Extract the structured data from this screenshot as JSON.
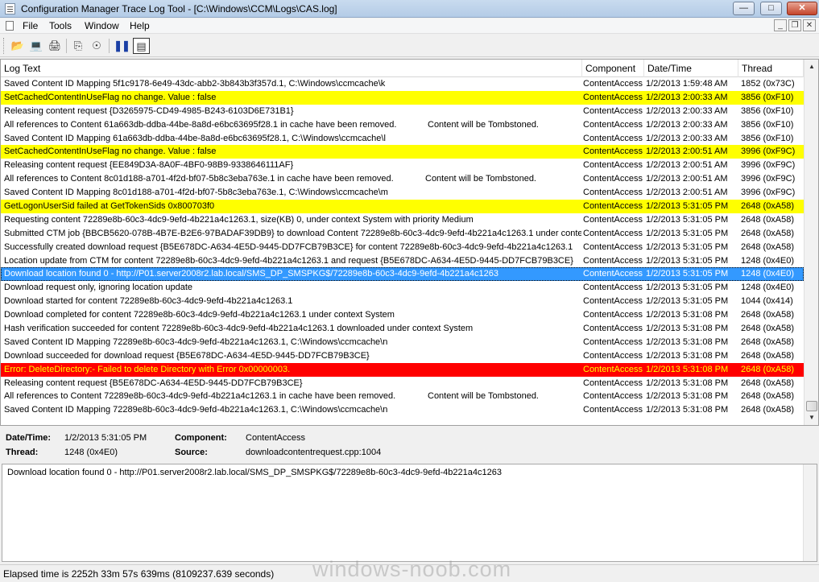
{
  "window": {
    "title": "Configuration Manager Trace Log Tool - [C:\\Windows\\CCM\\Logs\\CAS.log]",
    "min_glyph": "—",
    "max_glyph": "□",
    "close_glyph": "✕"
  },
  "menu": {
    "items": [
      "File",
      "Tools",
      "Window",
      "Help"
    ],
    "mdi_min": "_",
    "mdi_restore": "❐",
    "mdi_close": "✕"
  },
  "toolbar": {
    "buttons": [
      {
        "icon": "open-folder-icon",
        "glyph": "📂"
      },
      {
        "icon": "open-remote-icon",
        "glyph": "💻"
      },
      {
        "icon": "print-icon",
        "glyph": "🖨"
      },
      {
        "icon": "copy-icon",
        "glyph": "⎘"
      },
      {
        "icon": "find-icon",
        "glyph": "☉"
      },
      {
        "icon": "pause-icon",
        "glyph": "❚❚"
      },
      {
        "icon": "info-pane-icon",
        "glyph": "▤"
      }
    ]
  },
  "grid": {
    "columns": [
      "Log Text",
      "Component",
      "Date/Time",
      "Thread"
    ],
    "rows": [
      {
        "text": "Saved Content ID Mapping 5f1c9178-6e49-43dc-abb2-3b843b3f357d.1, C:\\Windows\\ccmcache\\k",
        "tomb": "",
        "component": "ContentAccess",
        "datetime": "1/2/2013 1:59:48 AM",
        "thread": "1852 (0x73C)",
        "status": "normal"
      },
      {
        "text": "SetCachedContentInUseFlag no change. Value : false",
        "tomb": "",
        "component": "ContentAccess",
        "datetime": "1/2/2013 2:00:33 AM",
        "thread": "3856 (0xF10)",
        "status": "warn"
      },
      {
        "text": "Releasing content request {D3265975-CD49-4985-B243-6103D6E731B1}",
        "tomb": "",
        "component": "ContentAccess",
        "datetime": "1/2/2013 2:00:33 AM",
        "thread": "3856 (0xF10)",
        "status": "normal"
      },
      {
        "text": "All references to Content 61a663db-ddba-44be-8a8d-e6bc63695f28.1 in cache have been removed.",
        "tomb": "Content will be Tombstoned.",
        "component": "ContentAccess",
        "datetime": "1/2/2013 2:00:33 AM",
        "thread": "3856 (0xF10)",
        "status": "normal"
      },
      {
        "text": "Saved Content ID Mapping 61a663db-ddba-44be-8a8d-e6bc63695f28.1, C:\\Windows\\ccmcache\\l",
        "tomb": "",
        "component": "ContentAccess",
        "datetime": "1/2/2013 2:00:33 AM",
        "thread": "3856 (0xF10)",
        "status": "normal"
      },
      {
        "text": "SetCachedContentInUseFlag no change. Value : false",
        "tomb": "",
        "component": "ContentAccess",
        "datetime": "1/2/2013 2:00:51 AM",
        "thread": "3996 (0xF9C)",
        "status": "warn"
      },
      {
        "text": "Releasing content request {EE849D3A-8A0F-4BF0-98B9-9338646111AF}",
        "tomb": "",
        "component": "ContentAccess",
        "datetime": "1/2/2013 2:00:51 AM",
        "thread": "3996 (0xF9C)",
        "status": "normal"
      },
      {
        "text": "All references to Content 8c01d188-a701-4f2d-bf07-5b8c3eba763e.1 in cache have been removed.",
        "tomb": "Content will be Tombstoned.",
        "component": "ContentAccess",
        "datetime": "1/2/2013 2:00:51 AM",
        "thread": "3996 (0xF9C)",
        "status": "normal"
      },
      {
        "text": "Saved Content ID Mapping 8c01d188-a701-4f2d-bf07-5b8c3eba763e.1, C:\\Windows\\ccmcache\\m",
        "tomb": "",
        "component": "ContentAccess",
        "datetime": "1/2/2013 2:00:51 AM",
        "thread": "3996 (0xF9C)",
        "status": "normal"
      },
      {
        "text": "GetLogonUserSid failed at GetTokenSids 0x800703f0",
        "tomb": "",
        "component": "ContentAccess",
        "datetime": "1/2/2013 5:31:05 PM",
        "thread": "2648 (0xA58)",
        "status": "warn"
      },
      {
        "text": "Requesting content 72289e8b-60c3-4dc9-9efd-4b221a4c1263.1, size(KB) 0, under context System with priority Medium",
        "tomb": "",
        "component": "ContentAccess",
        "datetime": "1/2/2013 5:31:05 PM",
        "thread": "2648 (0xA58)",
        "status": "normal"
      },
      {
        "text": "Submitted CTM job {BBCB5620-078B-4B7E-B2E6-97BADAF39DB9} to download Content 72289e8b-60c3-4dc9-9efd-4b221a4c1263.1 under context ...",
        "tomb": "",
        "component": "ContentAccess",
        "datetime": "1/2/2013 5:31:05 PM",
        "thread": "2648 (0xA58)",
        "status": "normal"
      },
      {
        "text": "Successfully created download  request {B5E678DC-A634-4E5D-9445-DD7FCB79B3CE} for content 72289e8b-60c3-4dc9-9efd-4b221a4c1263.1",
        "tomb": "",
        "component": "ContentAccess",
        "datetime": "1/2/2013 5:31:05 PM",
        "thread": "2648 (0xA58)",
        "status": "normal"
      },
      {
        "text": "Location update from CTM for content 72289e8b-60c3-4dc9-9efd-4b221a4c1263.1 and request {B5E678DC-A634-4E5D-9445-DD7FCB79B3CE}",
        "tomb": "",
        "component": "ContentAccess",
        "datetime": "1/2/2013 5:31:05 PM",
        "thread": "1248 (0x4E0)",
        "status": "normal"
      },
      {
        "text": "Download location found 0 - http://P01.server2008r2.lab.local/SMS_DP_SMSPKG$/72289e8b-60c3-4dc9-9efd-4b221a4c1263",
        "tomb": "",
        "component": "ContentAccess",
        "datetime": "1/2/2013 5:31:05 PM",
        "thread": "1248 (0x4E0)",
        "status": "selected"
      },
      {
        "text": "Download request only, ignoring location update",
        "tomb": "",
        "component": "ContentAccess",
        "datetime": "1/2/2013 5:31:05 PM",
        "thread": "1248 (0x4E0)",
        "status": "normal"
      },
      {
        "text": "Download started for content 72289e8b-60c3-4dc9-9efd-4b221a4c1263.1",
        "tomb": "",
        "component": "ContentAccess",
        "datetime": "1/2/2013 5:31:05 PM",
        "thread": "1044 (0x414)",
        "status": "normal"
      },
      {
        "text": "Download completed for content 72289e8b-60c3-4dc9-9efd-4b221a4c1263.1 under context System",
        "tomb": "",
        "component": "ContentAccess",
        "datetime": "1/2/2013 5:31:08 PM",
        "thread": "2648 (0xA58)",
        "status": "normal"
      },
      {
        "text": "Hash verification succeeded for content 72289e8b-60c3-4dc9-9efd-4b221a4c1263.1 downloaded under context System",
        "tomb": "",
        "component": "ContentAccess",
        "datetime": "1/2/2013 5:31:08 PM",
        "thread": "2648 (0xA58)",
        "status": "normal"
      },
      {
        "text": "Saved Content ID Mapping 72289e8b-60c3-4dc9-9efd-4b221a4c1263.1, C:\\Windows\\ccmcache\\n",
        "tomb": "",
        "component": "ContentAccess",
        "datetime": "1/2/2013 5:31:08 PM",
        "thread": "2648 (0xA58)",
        "status": "normal"
      },
      {
        "text": "Download succeeded for download request {B5E678DC-A634-4E5D-9445-DD7FCB79B3CE}",
        "tomb": "",
        "component": "ContentAccess",
        "datetime": "1/2/2013 5:31:08 PM",
        "thread": "2648 (0xA58)",
        "status": "normal"
      },
      {
        "text": "Error: DeleteDirectory:- Failed to delete Directory  with Error 0x00000003.",
        "tomb": "",
        "component": "ContentAccess",
        "datetime": "1/2/2013 5:31:08 PM",
        "thread": "2648 (0xA58)",
        "status": "error"
      },
      {
        "text": "Releasing content request {B5E678DC-A634-4E5D-9445-DD7FCB79B3CE}",
        "tomb": "",
        "component": "ContentAccess",
        "datetime": "1/2/2013 5:31:08 PM",
        "thread": "2648 (0xA58)",
        "status": "normal"
      },
      {
        "text": "All references to Content 72289e8b-60c3-4dc9-9efd-4b221a4c1263.1 in cache have been removed.",
        "tomb": "Content will be Tombstoned.",
        "component": "ContentAccess",
        "datetime": "1/2/2013 5:31:08 PM",
        "thread": "2648 (0xA58)",
        "status": "normal"
      },
      {
        "text": "Saved Content ID Mapping 72289e8b-60c3-4dc9-9efd-4b221a4c1263.1, C:\\Windows\\ccmcache\\n",
        "tomb": "",
        "component": "ContentAccess",
        "datetime": "1/2/2013 5:31:08 PM",
        "thread": "2648 (0xA58)",
        "status": "normal"
      }
    ],
    "scroll_up": "▲",
    "scroll_down": "▼"
  },
  "details": {
    "datetime_label": "Date/Time:",
    "datetime_value": "1/2/2013 5:31:05 PM",
    "component_label": "Component:",
    "component_value": "ContentAccess",
    "thread_label": "Thread:",
    "thread_value": "1248 (0x4E0)",
    "source_label": "Source:",
    "source_value": "downloadcontentrequest.cpp:1004"
  },
  "message": {
    "text": "Download location found 0 - http://P01.server2008r2.lab.local/SMS_DP_SMSPKG$/72289e8b-60c3-4dc9-9efd-4b221a4c1263"
  },
  "status": {
    "text": "Elapsed time is 2252h 33m 57s 639ms (8109237.639 seconds)"
  },
  "watermark": "windows-noob.com",
  "colors": {
    "warn_bg": "#ffff00",
    "error_bg": "#ff0000",
    "error_fg": "#ffff00",
    "selected_bg": "#3399ff"
  }
}
